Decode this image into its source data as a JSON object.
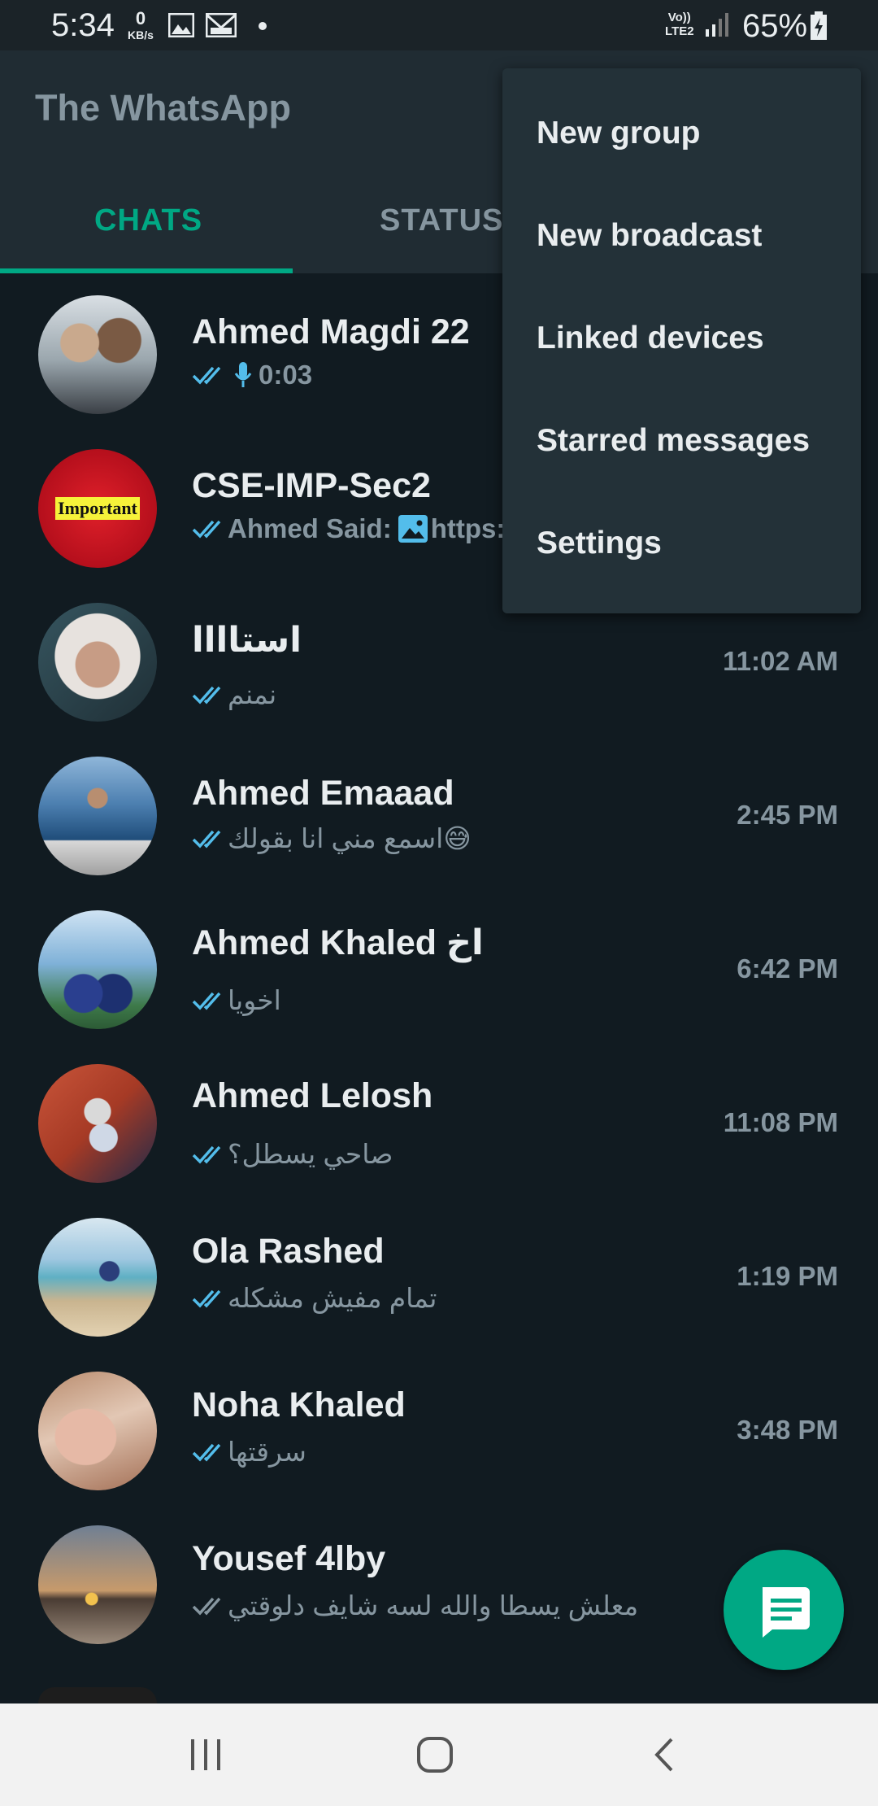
{
  "status_bar": {
    "time": "5:34",
    "net_speed_value": "0",
    "net_speed_unit": "KB/s",
    "volte": "Vo))",
    "lte": "LTE2",
    "battery": "65%",
    "icons": [
      "gallery-icon",
      "email-icon",
      "notification-dot",
      "signal-icon",
      "battery-icon"
    ]
  },
  "app_bar": {
    "title": "The WhatsApp"
  },
  "tabs": {
    "chats": "CHATS",
    "status": "STATUS",
    "active": "CHATS"
  },
  "menu": {
    "items": [
      "New group",
      "New broadcast",
      "Linked devices",
      "Starred messages",
      "Settings"
    ]
  },
  "chats": [
    {
      "name": "Ahmed Magdi 22",
      "preview": "0:03",
      "time": "",
      "ticks": "blue",
      "voice": true
    },
    {
      "name": "CSE-IMP-Sec2",
      "preview": "Ahmed Said: ",
      "link": "https:",
      "time": "",
      "ticks": "blue",
      "image": true,
      "avatar_text": "Important"
    },
    {
      "name": "استاااا",
      "preview": "نمنم",
      "time": "11:02 AM",
      "ticks": "blue"
    },
    {
      "name": "Ahmed Emaaad",
      "preview": "اسمع مني انا بقولك😅",
      "time": "2:45 PM",
      "ticks": "blue"
    },
    {
      "name": "Ahmed Khaled اخ",
      "preview": "اخويا",
      "time": "6:42 PM",
      "ticks": "blue"
    },
    {
      "name": "Ahmed Lelosh",
      "preview": "صاحي يسطل؟",
      "time": "11:08 PM",
      "ticks": "blue"
    },
    {
      "name": "Ola Rashed",
      "preview": "تمام مفيش مشكله",
      "time": "1:19 PM",
      "ticks": "blue"
    },
    {
      "name": "Noha Khaled",
      "preview": "سرقتها",
      "time": "3:48 PM",
      "ticks": "blue"
    },
    {
      "name": "Yousef 4lby",
      "preview": "معلش يسطا والله لسه شايف دلوقتي",
      "time": "",
      "ticks": "grey"
    }
  ],
  "colors": {
    "accent": "#00a884",
    "background": "#111b21",
    "header": "#202c33",
    "menu": "#233138",
    "read_tick": "#53bdeb",
    "secondary_text": "#8696a0"
  },
  "fab": {
    "icon": "new-chat-icon"
  },
  "nav_bar": {
    "icons": [
      "recent-apps-icon",
      "home-icon",
      "back-icon"
    ]
  }
}
